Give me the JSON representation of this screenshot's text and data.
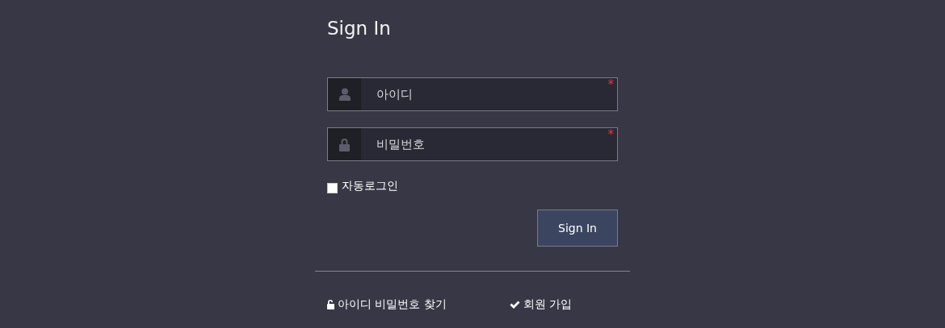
{
  "title": "Sign In",
  "fields": [
    {
      "kind": "user",
      "placeholder": "아이디",
      "required_mark": "*"
    },
    {
      "kind": "lock",
      "placeholder": "비밀번호",
      "required_mark": "*"
    }
  ],
  "remember": {
    "label": "자동로그인",
    "checked": false
  },
  "submit": "Sign In",
  "links": [
    {
      "kind": "unlock",
      "label": "아이디 비밀번호 찾기"
    },
    {
      "kind": "check",
      "label": "회원 가입"
    }
  ]
}
